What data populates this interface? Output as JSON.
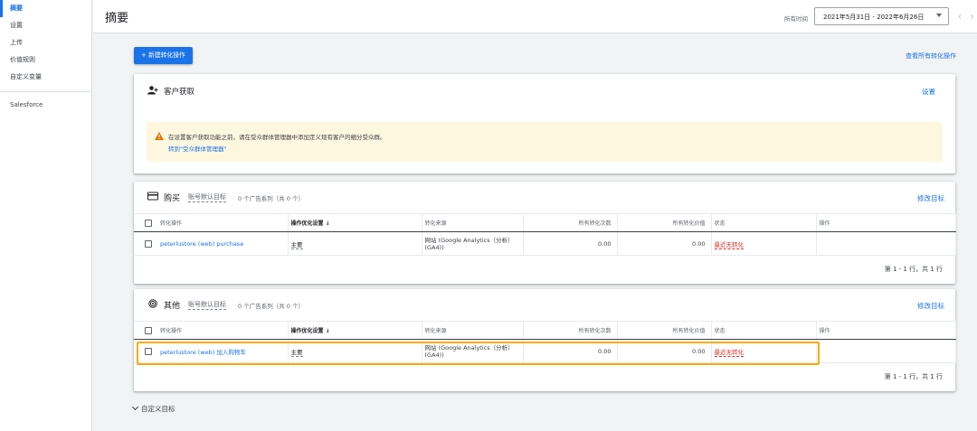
{
  "sidebar": {
    "items": [
      {
        "label": "摘要",
        "active": true
      },
      {
        "label": "设置",
        "active": false
      },
      {
        "label": "上传",
        "active": false
      },
      {
        "label": "价值规则",
        "active": false
      },
      {
        "label": "自定义变量",
        "active": false
      }
    ],
    "secondary": [
      {
        "label": "Salesforce"
      }
    ]
  },
  "header": {
    "title": "摘要",
    "date_label": "所有时间",
    "date_range": "2021年5月31日 - 2022年6月26日",
    "prev_icon": "chevron-left-icon",
    "next_icon": "chevron-right-icon"
  },
  "actions": {
    "new_label": "+ 新建转化操作",
    "view_all_label": "查看所有转化操作"
  },
  "acquisition": {
    "title": "客户获取",
    "icon": "person-add-icon",
    "settings_label": "设置",
    "warning_text": "在设置客户获取功能之前，请在受众群体管理器中添加定义现有客户的细分受众群。",
    "warning_link": "转到\"受众群体管理器\"",
    "warning_color": "#fef7e0",
    "warning_icon_color": "#e37400"
  },
  "goals": [
    {
      "name": "购买",
      "icon": "credit-card-icon",
      "default_label": "账号默认目标",
      "count_label": "0 个广告系列（共 0 个）",
      "edit_label": "修改目标",
      "columns": [
        "转化操作",
        "操作优化设置 ↓",
        "转化来源",
        "所有转化次数",
        "所有转化价值",
        "状态",
        "操作"
      ],
      "rows": [
        {
          "action": "peterlustore (web) purchase",
          "optimization": "主要",
          "source": "网站 (Google Analytics（分析）(GA4))",
          "conversions": "0.00",
          "value": "0.00",
          "status": "最近无转化",
          "ops": ""
        }
      ],
      "pager": "第 1 - 1 行，共 1 行"
    },
    {
      "name": "其他",
      "icon": "target-icon",
      "default_label": "账号默认目标",
      "count_label": "0 个广告系列（共 0 个）",
      "edit_label": "修改目标",
      "columns": [
        "转化操作",
        "操作优化设置 ↓",
        "转化来源",
        "所有转化次数",
        "所有转化价值",
        "状态",
        "操作"
      ],
      "rows": [
        {
          "action": "peterlustore (web) 加入购物车",
          "optimization": "主要",
          "source": "网站 (Google Analytics（分析）(GA4))",
          "conversions": "0.00",
          "value": "0.00",
          "status": "最近无转化",
          "ops": ""
        }
      ],
      "pager": "第 1 - 1 行，共 1 行"
    }
  ],
  "custom_goals": {
    "label": "自定义目标"
  },
  "colors": {
    "accent": "#1a73e8",
    "status_red": "#d93025",
    "highlight": "#f9ab00"
  }
}
